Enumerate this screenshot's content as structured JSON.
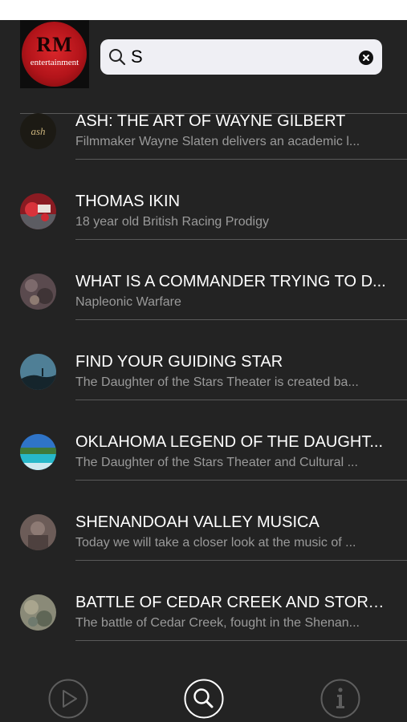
{
  "logo": {
    "monogram": "RM",
    "wordmark": "entertainment"
  },
  "search": {
    "query": "S",
    "placeholder": ""
  },
  "results": [
    {
      "title": "ASH: THE ART OF WAYNE GILBERT",
      "subtitle": "Filmmaker Wayne Slaten delivers an academic l...",
      "thumb_text": "ash"
    },
    {
      "title": "THOMAS IKIN",
      "subtitle": "18 year old British Racing Prodigy"
    },
    {
      "title": "WHAT IS A COMMANDER TRYING TO D...",
      "subtitle": "Napleonic Warfare"
    },
    {
      "title": "FIND YOUR GUIDING STAR",
      "subtitle": "The Daughter of the Stars Theater is created ba..."
    },
    {
      "title": "OKLAHOMA LEGEND OF THE DAUGHT...",
      "subtitle": "The Daughter of the Stars Theater and Cultural ..."
    },
    {
      "title": "SHENANDOAH VALLEY MUSICA",
      "subtitle": "Today we will take a closer look at the music of ..."
    },
    {
      "title": "BATTLE OF CEDAR CREEK AND STORY ...",
      "subtitle": "The battle of Cedar Creek, fought in the Shenan..."
    }
  ],
  "tabs": [
    {
      "icon": "play-icon",
      "active": false
    },
    {
      "icon": "search-icon",
      "active": true
    },
    {
      "icon": "info-icon",
      "active": false
    }
  ],
  "colors": {
    "background": "#232323",
    "text": "#ffffff",
    "subtext": "#9a9a9a",
    "separator": "#5a5a5a",
    "inactive_tab": "#5e5e5e",
    "active_tab": "#ffffff"
  }
}
